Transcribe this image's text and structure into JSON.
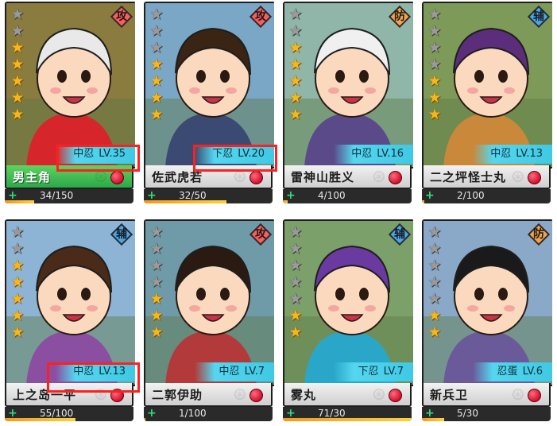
{
  "cards": [
    {
      "name": "男主角",
      "tier": "中忍",
      "level": "LV.35",
      "xp": "34/150",
      "xp_fraction": 0.227,
      "role": "攻",
      "role_color": "#ff5b5b",
      "stars": 5,
      "namebar": "green",
      "portrait_bg": "#8a7b3f",
      "hair": "#e9e9e9",
      "accent": "#d6262c",
      "highlighted": true,
      "add_icon": "+"
    },
    {
      "name": "佐武虎若",
      "tier": "下忍",
      "level": "LV.20",
      "xp": "32/50",
      "xp_fraction": 0.64,
      "role": "攻",
      "role_color": "#ff5b5b",
      "stars": 4,
      "namebar": "gray",
      "portrait_bg": "#7aa7c6",
      "hair": "#3a2414",
      "accent": "#3b4a72",
      "highlighted": true,
      "add_icon": "+"
    },
    {
      "name": "雷神山胜义",
      "tier": "中忍",
      "level": "LV.16",
      "xp": "4/100",
      "xp_fraction": 0.04,
      "role": "防",
      "role_color": "#f5a24a",
      "stars": 5,
      "namebar": "gray",
      "portrait_bg": "#8fb6a8",
      "hair": "#f0f0f0",
      "accent": "#5a4a8a",
      "highlighted": false,
      "add_icon": "+"
    },
    {
      "name": "二之坪怪士丸",
      "tier": "中忍",
      "level": "LV.13",
      "xp": "2/100",
      "xp_fraction": 0.02,
      "role": "辅",
      "role_color": "#47a7f0",
      "stars": 3,
      "namebar": "gray",
      "portrait_bg": "#7e9a58",
      "hair": "#5b2d7a",
      "accent": "#c9883a",
      "highlighted": false,
      "add_icon": "+"
    },
    {
      "name": "上之岛一平",
      "tier": "中忍",
      "level": "LV.13",
      "xp": "55/100",
      "xp_fraction": 0.55,
      "role": "辅",
      "role_color": "#47a7f0",
      "stars": 5,
      "namebar": "gray",
      "portrait_bg": "#8db4d4",
      "hair": "#4a2a18",
      "accent": "#8a4fa0",
      "highlighted": true,
      "add_icon": "+"
    },
    {
      "name": "二郭伊助",
      "tier": "中忍",
      "level": "LV.7",
      "xp": "1/100",
      "xp_fraction": 0.01,
      "role": "攻",
      "role_color": "#ff5b5b",
      "stars": 3,
      "namebar": "gray",
      "portrait_bg": "#6f9aa8",
      "hair": "#2a1a12",
      "accent": "#b23a3a",
      "highlighted": false,
      "add_icon": "+"
    },
    {
      "name": "雾丸",
      "tier": "下忍",
      "level": "LV.7",
      "xp": "71/30",
      "xp_fraction": 1.0,
      "role": "辅",
      "role_color": "#47a7f0",
      "stars": 2,
      "namebar": "gray",
      "portrait_bg": "#7ca06a",
      "hair": "#6a3aa0",
      "accent": "#2aa7c8",
      "highlighted": false,
      "add_icon": "+"
    },
    {
      "name": "新兵卫",
      "tier": "忍蛋",
      "level": "LV.6",
      "xp": "5/30",
      "xp_fraction": 0.17,
      "role": "防",
      "role_color": "#f5a24a",
      "stars": 2,
      "namebar": "gray",
      "portrait_bg": "#8aa9c8",
      "hair": "#1a1a1a",
      "accent": "#6a5a9a",
      "highlighted": false,
      "add_icon": "+"
    }
  ]
}
